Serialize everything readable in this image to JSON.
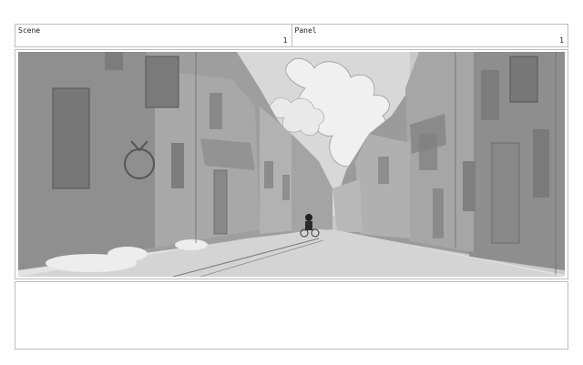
{
  "header": {
    "scene_label": "Scene",
    "scene_value": "1",
    "panel_label": "Panel",
    "panel_value": "1"
  },
  "panel": {
    "image_name": "storyboard-sketch-street"
  },
  "notes": {
    "text": ""
  }
}
